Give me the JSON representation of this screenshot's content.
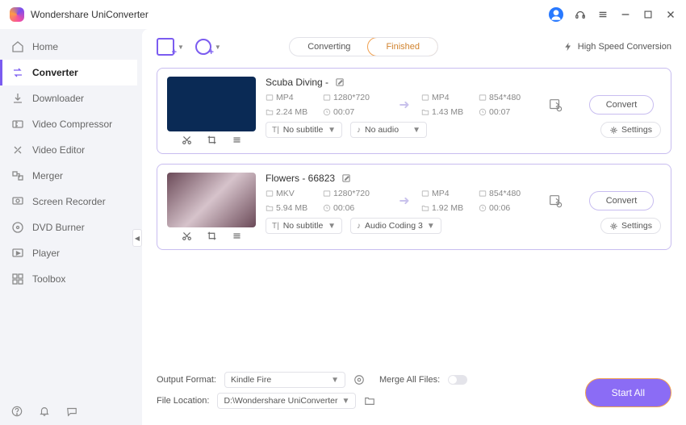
{
  "app": {
    "title": "Wondershare UniConverter"
  },
  "sidebar": {
    "items": [
      {
        "label": "Home",
        "icon": "home"
      },
      {
        "label": "Converter",
        "icon": "converter",
        "active": true
      },
      {
        "label": "Downloader",
        "icon": "download"
      },
      {
        "label": "Video Compressor",
        "icon": "compress"
      },
      {
        "label": "Video Editor",
        "icon": "editor"
      },
      {
        "label": "Merger",
        "icon": "merge"
      },
      {
        "label": "Screen Recorder",
        "icon": "record"
      },
      {
        "label": "DVD Burner",
        "icon": "dvd"
      },
      {
        "label": "Player",
        "icon": "play"
      },
      {
        "label": "Toolbox",
        "icon": "toolbox"
      }
    ]
  },
  "tabs": {
    "converting": "Converting",
    "finished": "Finished",
    "active": "finished"
  },
  "hsc": "High Speed Conversion",
  "items": [
    {
      "title": "Scuba Diving -",
      "src": {
        "fmt": "MP4",
        "res": "1280*720",
        "size": "2.24 MB",
        "dur": "00:07"
      },
      "dst": {
        "fmt": "MP4",
        "res": "854*480",
        "size": "1.43 MB",
        "dur": "00:07"
      },
      "subtitle": "No subtitle",
      "audio": "No audio",
      "convert": "Convert",
      "settings": "Settings"
    },
    {
      "title": "Flowers - 66823",
      "src": {
        "fmt": "MKV",
        "res": "1280*720",
        "size": "5.94 MB",
        "dur": "00:06"
      },
      "dst": {
        "fmt": "MP4",
        "res": "854*480",
        "size": "1.92 MB",
        "dur": "00:06"
      },
      "subtitle": "No subtitle",
      "audio": "Audio Coding 3",
      "convert": "Convert",
      "settings": "Settings"
    }
  ],
  "footer": {
    "output_format_label": "Output Format:",
    "output_format_value": "Kindle Fire",
    "merge_label": "Merge All Files:",
    "file_location_label": "File Location:",
    "file_location_value": "D:\\Wondershare UniConverter",
    "start_all": "Start All"
  }
}
